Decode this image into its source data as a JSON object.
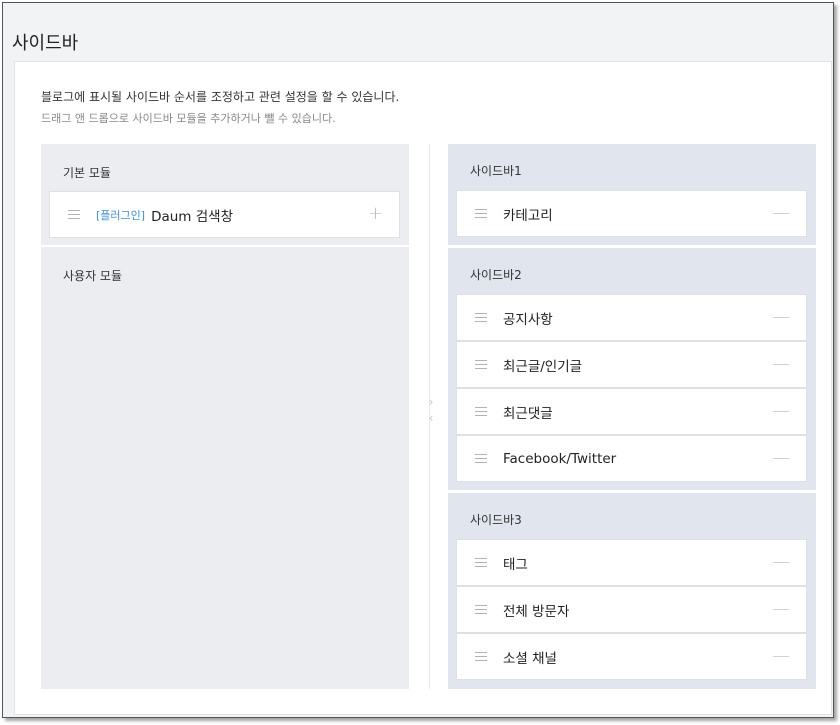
{
  "page": {
    "title": "사이드바"
  },
  "description": {
    "line1": "블로그에 표시될 사이드바 순서를 조정하고 관련 설정을 할 수 있습니다.",
    "line2": "드래그 앤 드롭으로 사이드바 모듈을 추가하거나 뺄 수 있습니다."
  },
  "basic_modules": {
    "title": "기본 모듈",
    "items": [
      {
        "tag": "[플러그인]",
        "label": "Daum 검색창",
        "action": "+"
      }
    ]
  },
  "user_modules": {
    "title": "사용자 모듈"
  },
  "divider": {
    "chevron_right": "›",
    "chevron_left": "‹"
  },
  "sidebars": [
    {
      "title": "사이드바1",
      "items": [
        {
          "label": "카테고리",
          "action": "—"
        }
      ]
    },
    {
      "title": "사이드바2",
      "items": [
        {
          "label": "공지사항",
          "action": "—"
        },
        {
          "label": "최근글/인기글",
          "action": "—"
        },
        {
          "label": "최근댓글",
          "action": "—"
        },
        {
          "label": "Facebook/Twitter",
          "action": "—"
        }
      ]
    },
    {
      "title": "사이드바3",
      "items": [
        {
          "label": "태그",
          "action": "—"
        },
        {
          "label": "전체 방문자",
          "action": "—"
        },
        {
          "label": "소셜 채널",
          "action": "—"
        }
      ]
    }
  ]
}
